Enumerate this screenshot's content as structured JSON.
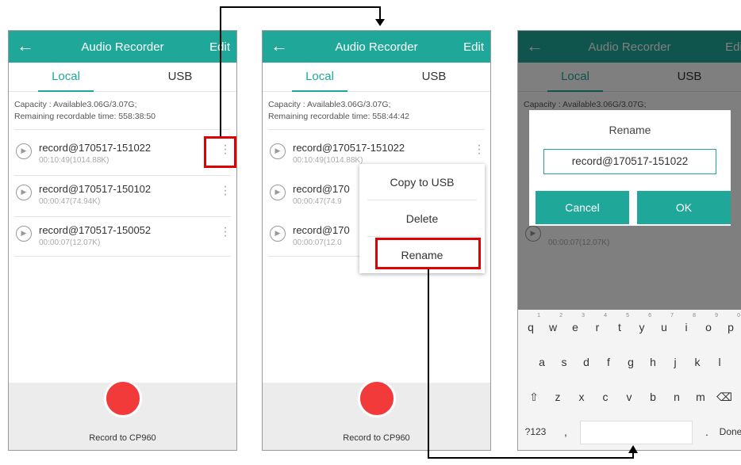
{
  "header": {
    "title": "Audio Recorder",
    "edit_label": "Edit"
  },
  "tabs": {
    "local": "Local",
    "usb": "USB"
  },
  "screen1": {
    "capacity": "Capacity : Available3.06G/3.07G;",
    "remaining": "Remaining recordable time: 558:38:50",
    "records": [
      {
        "name": "record@170517-151022",
        "meta": "00:10:49(1014.88K)"
      },
      {
        "name": "record@170517-150102",
        "meta": "00:00:47(74.94K)"
      },
      {
        "name": "record@170517-150052",
        "meta": "00:00:07(12.07K)"
      }
    ]
  },
  "screen2": {
    "capacity": "Capacity : Available3.06G/3.07G;",
    "remaining": "Remaining recordable time: 558:44:42",
    "records": [
      {
        "name": "record@170517-151022",
        "meta": "00:10:49(1014.88K)"
      },
      {
        "name": "record@170",
        "meta": "00:00:47(74.9"
      },
      {
        "name": "record@170",
        "meta": "00:00:07(12.0"
      }
    ],
    "menu": {
      "copy": "Copy to USB",
      "delete": "Delete",
      "rename": "Rename"
    }
  },
  "screen3": {
    "capacity": "Capacity : Available3.06G/3.07G;",
    "bg_record_meta": "00:00:07(12.07K)",
    "dialog": {
      "title": "Rename",
      "value": "record@170517-151022",
      "cancel": "Cancel",
      "ok": "OK"
    },
    "keyboard": {
      "row1": [
        "q",
        "w",
        "e",
        "r",
        "t",
        "y",
        "u",
        "i",
        "o",
        "p"
      ],
      "row1_nums": [
        "1",
        "2",
        "3",
        "4",
        "5",
        "6",
        "7",
        "8",
        "9",
        "0"
      ],
      "row2": [
        "a",
        "s",
        "d",
        "f",
        "g",
        "h",
        "j",
        "k",
        "l"
      ],
      "row3": [
        "⇧",
        "z",
        "x",
        "c",
        "v",
        "b",
        "n",
        "m",
        "⌫"
      ],
      "row4_left": "?123",
      "row4_comma": ",",
      "row4_period": ".",
      "row4_done": "Done"
    }
  },
  "footer": {
    "record_label": "Record to CP960"
  },
  "colors": {
    "accent": "#1fa89a",
    "record": "#f23a3a",
    "highlight": "#e00000"
  }
}
